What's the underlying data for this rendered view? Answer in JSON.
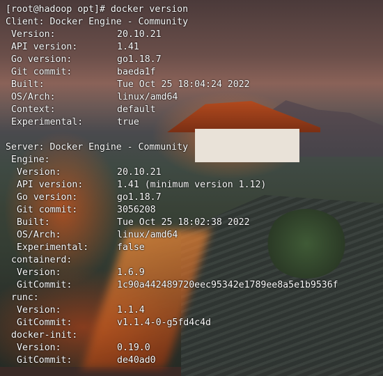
{
  "terminal": {
    "prompt": "[root@hadoop opt]# ",
    "command": "docker version",
    "client_header": "Client: Docker Engine - Community",
    "client": [
      {
        "key": "Version:",
        "value": "20.10.21"
      },
      {
        "key": "API version:",
        "value": "1.41"
      },
      {
        "key": "Go version:",
        "value": "go1.18.7"
      },
      {
        "key": "Git commit:",
        "value": "baeda1f"
      },
      {
        "key": "Built:",
        "value": "Tue Oct 25 18:04:24 2022"
      },
      {
        "key": "OS/Arch:",
        "value": "linux/amd64"
      },
      {
        "key": "Context:",
        "value": "default"
      },
      {
        "key": "Experimental:",
        "value": "true"
      }
    ],
    "server_header": "Server: Docker Engine - Community",
    "engine_label": "Engine:",
    "engine": [
      {
        "key": "Version:",
        "value": "20.10.21"
      },
      {
        "key": "API version:",
        "value": "1.41 (minimum version 1.12)"
      },
      {
        "key": "Go version:",
        "value": "go1.18.7"
      },
      {
        "key": "Git commit:",
        "value": "3056208"
      },
      {
        "key": "Built:",
        "value": "Tue Oct 25 18:02:38 2022"
      },
      {
        "key": "OS/Arch:",
        "value": "linux/amd64"
      },
      {
        "key": "Experimental:",
        "value": "false"
      }
    ],
    "containerd_label": "containerd:",
    "containerd": [
      {
        "key": "Version:",
        "value": "1.6.9"
      },
      {
        "key": "GitCommit:",
        "value": "1c90a442489720eec95342e1789ee8a5e1b9536f"
      }
    ],
    "runc_label": "runc:",
    "runc": [
      {
        "key": "Version:",
        "value": "1.1.4"
      },
      {
        "key": "GitCommit:",
        "value": "v1.1.4-0-g5fd4c4d"
      }
    ],
    "dockerinit_label": "docker-init:",
    "dockerinit": [
      {
        "key": "Version:",
        "value": "0.19.0"
      },
      {
        "key": "GitCommit:",
        "value": "de40ad0"
      }
    ]
  }
}
